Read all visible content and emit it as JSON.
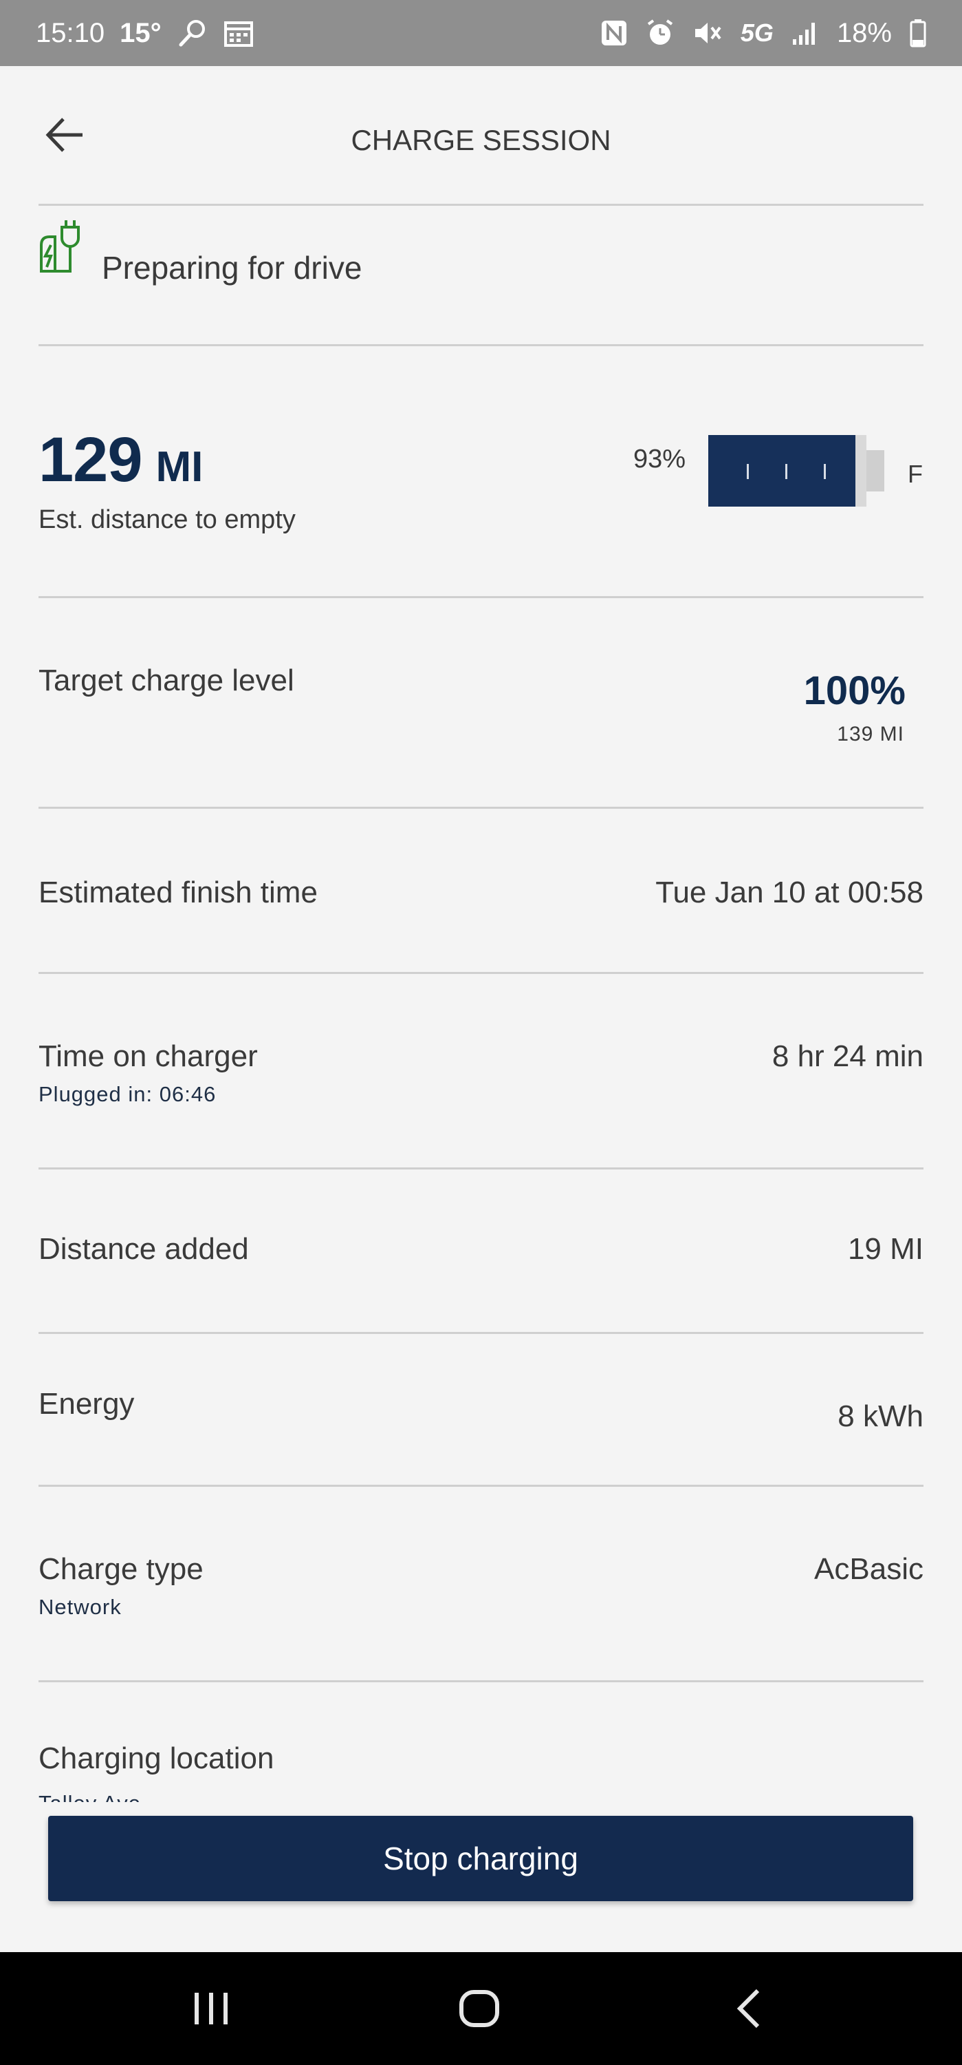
{
  "status_bar": {
    "time": "15:10",
    "temperature": "15°",
    "battery": "18%",
    "network": "5G"
  },
  "header": {
    "title": "CHARGE SESSION"
  },
  "charge_status": {
    "text": "Preparing for drive"
  },
  "range": {
    "value": "129",
    "unit": "MI",
    "label": "Est. distance to empty",
    "battery_percent_text": "93%",
    "battery_level": 0.93,
    "full_marker": "F"
  },
  "rows": {
    "target": {
      "label": "Target charge level",
      "value": "100%",
      "sub_value": "139 MI"
    },
    "finish": {
      "label": "Estimated finish time",
      "value": "Tue Jan 10 at 00:58"
    },
    "time_on_charger": {
      "label": "Time on charger",
      "sub": "Plugged in: 06:46",
      "value": "8 hr 24 min"
    },
    "distance_added": {
      "label": "Distance added",
      "value": "19 MI"
    },
    "energy": {
      "label": "Energy",
      "value": "8 kWh"
    },
    "charge_type": {
      "label": "Charge type",
      "sub": "Network",
      "value": "AcBasic"
    },
    "location": {
      "label": "Charging location",
      "sub": "Talley Ave"
    }
  },
  "actions": {
    "stop_label": "Stop charging"
  },
  "colors": {
    "brand_navy": "#132a4f",
    "accent_green": "#2e8b2e",
    "divider": "#cfcfcf"
  }
}
